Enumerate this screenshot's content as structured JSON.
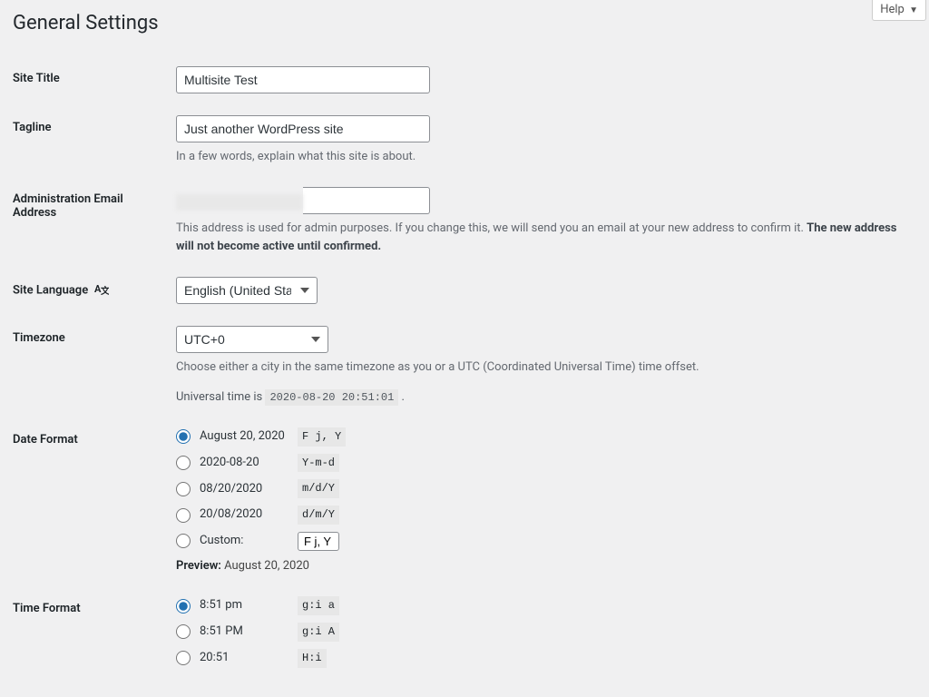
{
  "help": {
    "label": "Help"
  },
  "page": {
    "title": "General Settings"
  },
  "fields": {
    "site_title": {
      "label": "Site Title",
      "value": "Multisite Test"
    },
    "tagline": {
      "label": "Tagline",
      "value": "Just another WordPress site",
      "desc": "In a few words, explain what this site is about."
    },
    "admin_email": {
      "label": "Administration Email Address",
      "desc_prefix": "This address is used for admin purposes. If you change this, we will send you an email at your new address to confirm it. ",
      "desc_strong": "The new address will not become active until confirmed."
    },
    "site_language": {
      "label": "Site Language",
      "value": "English (United States)"
    },
    "timezone": {
      "label": "Timezone",
      "value": "UTC+0",
      "desc": "Choose either a city in the same timezone as you or a UTC (Coordinated Universal Time) time offset.",
      "universal_prefix": "Universal time is ",
      "universal_code": "2020-08-20 20:51:01",
      "universal_suffix": " ."
    },
    "date_format": {
      "label": "Date Format",
      "options": [
        {
          "label": "August 20, 2020",
          "code": "F j, Y",
          "checked": true
        },
        {
          "label": "2020-08-20",
          "code": "Y-m-d",
          "checked": false
        },
        {
          "label": "08/20/2020",
          "code": "m/d/Y",
          "checked": false
        },
        {
          "label": "20/08/2020",
          "code": "d/m/Y",
          "checked": false
        }
      ],
      "custom_label": "Custom:",
      "custom_value": "F j, Y",
      "preview_label": "Preview:",
      "preview_value": "August 20, 2020"
    },
    "time_format": {
      "label": "Time Format",
      "options": [
        {
          "label": "8:51 pm",
          "code": "g:i a",
          "checked": true
        },
        {
          "label": "8:51 PM",
          "code": "g:i A",
          "checked": false
        },
        {
          "label": "20:51",
          "code": "H:i",
          "checked": false
        }
      ]
    }
  }
}
